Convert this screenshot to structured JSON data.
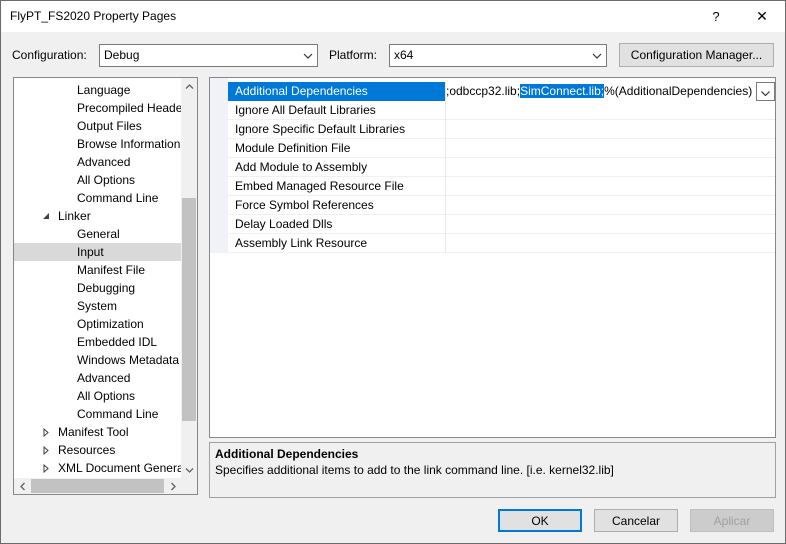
{
  "window": {
    "title": "FlyPT_FS2020 Property Pages",
    "help_glyph": "?",
    "close_glyph": "✕"
  },
  "config": {
    "configuration_label": "Configuration:",
    "configuration_value": "Debug",
    "platform_label": "Platform:",
    "platform_value": "x64",
    "manager_button": "Configuration Manager..."
  },
  "tree": {
    "items": [
      {
        "label": "Language",
        "indent": 2
      },
      {
        "label": "Precompiled Heade",
        "indent": 2
      },
      {
        "label": "Output Files",
        "indent": 2
      },
      {
        "label": "Browse Information",
        "indent": 2
      },
      {
        "label": "Advanced",
        "indent": 2
      },
      {
        "label": "All Options",
        "indent": 2
      },
      {
        "label": "Command Line",
        "indent": 2
      },
      {
        "label": "Linker",
        "indent": 1,
        "expander": "expanded"
      },
      {
        "label": "General",
        "indent": 2
      },
      {
        "label": "Input",
        "indent": 2,
        "selected": true
      },
      {
        "label": "Manifest File",
        "indent": 2
      },
      {
        "label": "Debugging",
        "indent": 2
      },
      {
        "label": "System",
        "indent": 2
      },
      {
        "label": "Optimization",
        "indent": 2
      },
      {
        "label": "Embedded IDL",
        "indent": 2
      },
      {
        "label": "Windows Metadata",
        "indent": 2
      },
      {
        "label": "Advanced",
        "indent": 2
      },
      {
        "label": "All Options",
        "indent": 2
      },
      {
        "label": "Command Line",
        "indent": 2
      },
      {
        "label": "Manifest Tool",
        "indent": 1,
        "expander": "collapsed"
      },
      {
        "label": "Resources",
        "indent": 1,
        "expander": "collapsed"
      },
      {
        "label": "XML Document Genera",
        "indent": 1,
        "expander": "collapsed"
      }
    ]
  },
  "properties": {
    "rows": [
      {
        "name": "Additional Dependencies",
        "selected": true
      },
      {
        "name": "Ignore All Default Libraries"
      },
      {
        "name": "Ignore Specific Default Libraries"
      },
      {
        "name": "Module Definition File"
      },
      {
        "name": "Add Module to Assembly"
      },
      {
        "name": "Embed Managed Resource File"
      },
      {
        "name": "Force Symbol References"
      },
      {
        "name": "Delay Loaded Dlls"
      },
      {
        "name": "Assembly Link Resource"
      }
    ],
    "edit_value_before": ";odbccp32.lib;",
    "edit_value_selected": "SimConnect.lib;",
    "edit_value_after": "%(AdditionalDependencies)"
  },
  "description": {
    "title": "Additional Dependencies",
    "text": "Specifies additional items to add to the link command line. [i.e. kernel32.lib]"
  },
  "buttons": {
    "ok": "OK",
    "cancel": "Cancelar",
    "apply": "Aplicar"
  },
  "colors": {
    "accent": "#0078d7",
    "tree_selected": "#d9d9d9"
  }
}
